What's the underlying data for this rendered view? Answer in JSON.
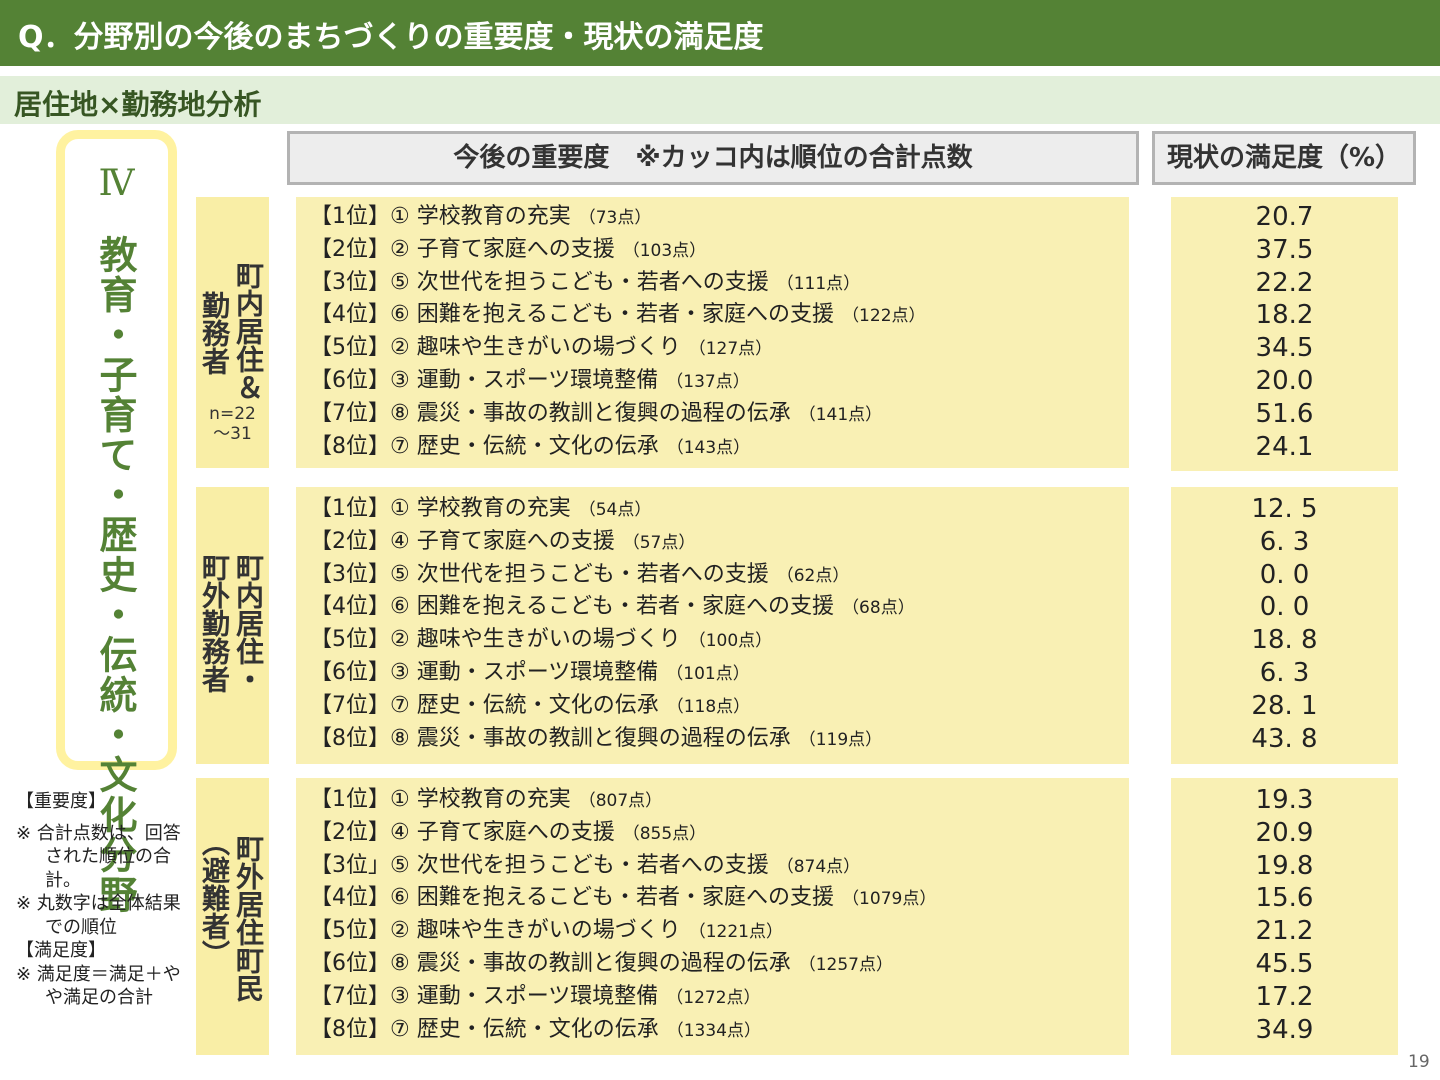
{
  "title": "Q．分野別の今後のまちづくりの重要度・現状の満足度",
  "subtitle": "居住地×勤務地分析",
  "category": {
    "roman": "Ⅳ",
    "label": "教育・子育て・歴史・伝統・文化分野"
  },
  "headers": {
    "importance": "今後の重要度　※カッコ内は順位の合計点数",
    "satisfaction": "現状の満足度（%）"
  },
  "groups": [
    {
      "label_lines": [
        "町内居住＆",
        "勤務者"
      ],
      "n": "n=22\n～31",
      "items": [
        {
          "text": "【1位】① 学校教育の充実",
          "pts": "（73点）"
        },
        {
          "text": "【2位】② 子育て家庭への支援",
          "pts": "（103点）"
        },
        {
          "text": "【3位】⑤ 次世代を担うこども・若者への支援",
          "pts": "（111点）"
        },
        {
          "text": "【4位】⑥ 困難を抱えるこども・若者・家庭への支援",
          "pts": "（122点）"
        },
        {
          "text": "【5位】② 趣味や生きがいの場づくり",
          "pts": "（127点）"
        },
        {
          "text": "【6位】③ 運動・スポーツ環境整備",
          "pts": "（137点）"
        },
        {
          "text": "【7位】⑧ 震災・事故の教訓と復興の過程の伝承",
          "pts": "（141点）"
        },
        {
          "text": "【8位】⑦ 歴史・伝統・文化の伝承",
          "pts": "（143点）"
        }
      ],
      "satisfaction": [
        "20.7",
        "37.5",
        "22.2",
        "18.2",
        "34.5",
        "20.0",
        "51.6",
        "24.1"
      ]
    },
    {
      "label_lines": [
        "町内居住・",
        "町外勤務者"
      ],
      "n": "",
      "items": [
        {
          "text": "【1位】① 学校教育の充実",
          "pts": "（54点）"
        },
        {
          "text": "【2位】④ 子育て家庭への支援",
          "pts": "（57点）"
        },
        {
          "text": "【3位】⑤ 次世代を担うこども・若者への支援",
          "pts": "（62点）"
        },
        {
          "text": "【4位】⑥ 困難を抱えるこども・若者・家庭への支援",
          "pts": "（68点）"
        },
        {
          "text": "【5位】② 趣味や生きがいの場づくり",
          "pts": "（100点）"
        },
        {
          "text": "【6位】③ 運動・スポーツ環境整備",
          "pts": "（101点）"
        },
        {
          "text": "【7位】⑦ 歴史・伝統・文化の伝承",
          "pts": "（118点）"
        },
        {
          "text": "【8位】⑧ 震災・事故の教訓と復興の過程の伝承",
          "pts": "（119点）"
        }
      ],
      "satisfaction": [
        "12. 5",
        "6. 3",
        "0. 0",
        "0. 0",
        "18. 8",
        "6. 3",
        "28. 1",
        "43. 8"
      ]
    },
    {
      "label_lines": [
        "町外居住町民",
        "（避難者）"
      ],
      "n": "",
      "items": [
        {
          "text": "【1位】① 学校教育の充実",
          "pts": "（807点）"
        },
        {
          "text": "【2位】④ 子育て家庭への支援",
          "pts": "（855点）"
        },
        {
          "text": "【3位」⑤ 次世代を担うこども・若者への支援",
          "pts": "（874点）"
        },
        {
          "text": "【4位】⑥ 困難を抱えるこども・若者・家庭への支援",
          "pts": "（1079点）"
        },
        {
          "text": "【5位】② 趣味や生きがいの場づくり",
          "pts": "（1221点）"
        },
        {
          "text": "【6位】⑧ 震災・事故の教訓と復興の過程の伝承",
          "pts": "（1257点）"
        },
        {
          "text": "【7位】③ 運動・スポーツ環境整備",
          "pts": "（1272点）"
        },
        {
          "text": "【8位】⑦ 歴史・伝統・文化の伝承",
          "pts": "（1334点）"
        }
      ],
      "satisfaction": [
        "19.3",
        "20.9",
        "19.8",
        "15.6",
        "21.2",
        "45.5",
        "17.2",
        "34.9"
      ]
    }
  ],
  "notes": {
    "importance_head": "【重要度】",
    "note1": "※ 合計点数は、回答された順位の合計。",
    "note2": "※ 丸数字は全体結果での順位",
    "satisfaction_head": "【満足度】",
    "note3": "※ 満足度＝満足＋やや満足の合計"
  },
  "page_number": "19"
}
